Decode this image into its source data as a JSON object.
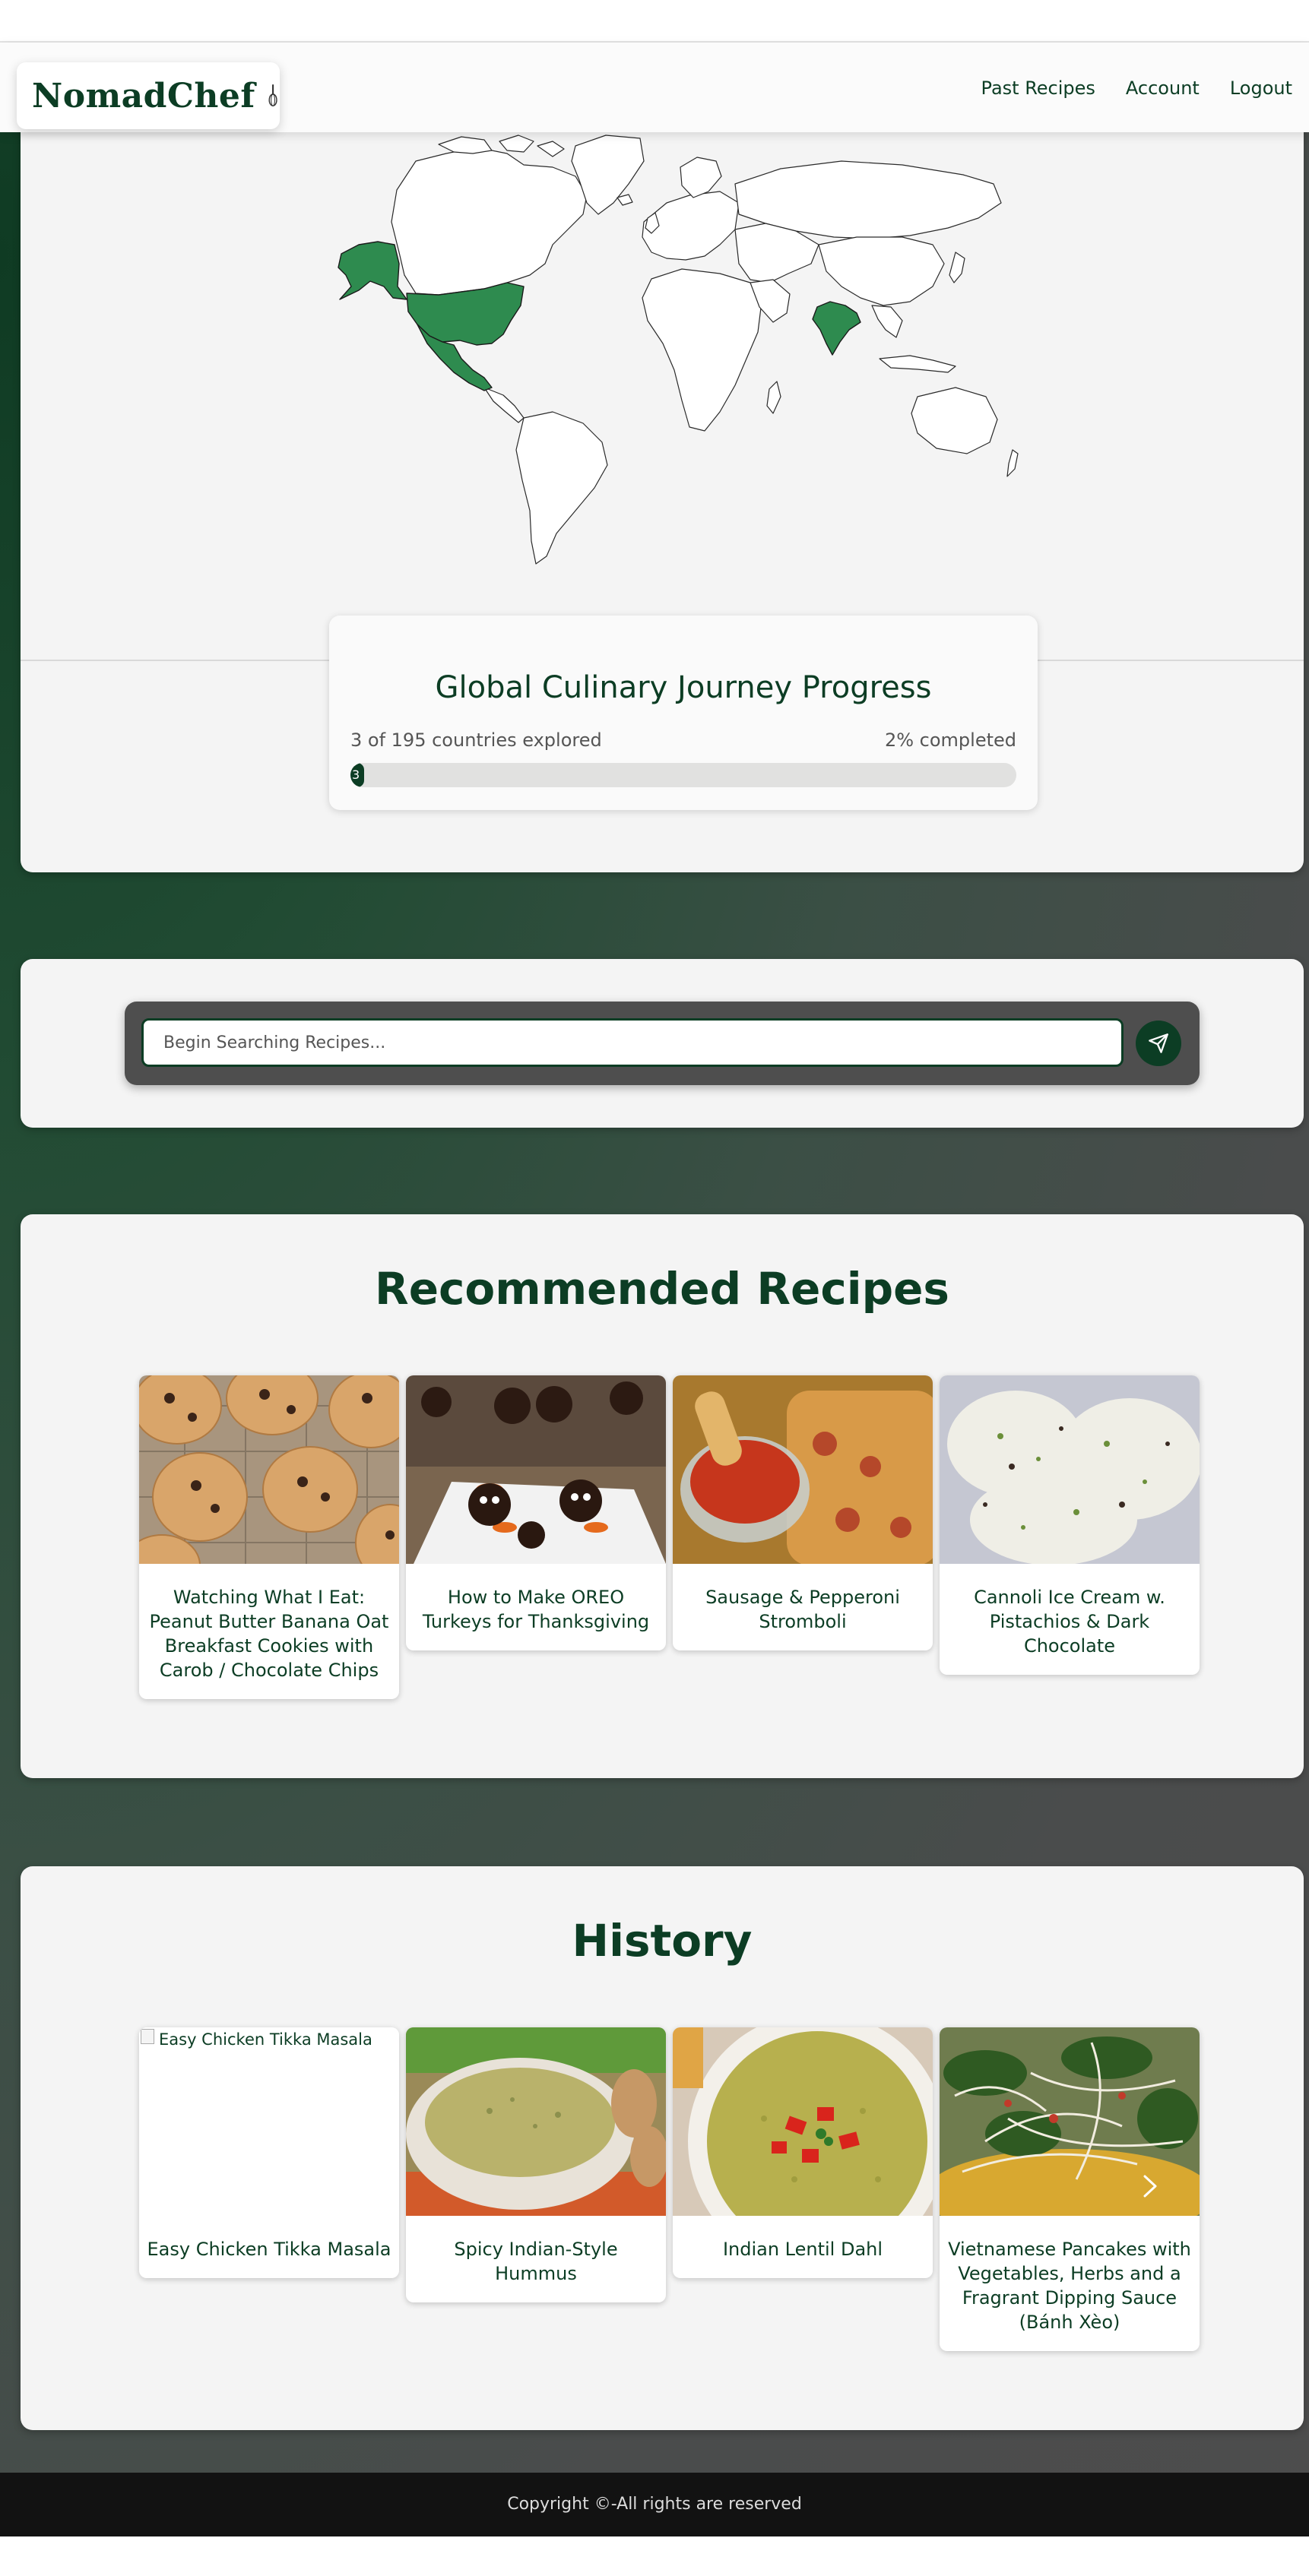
{
  "brand": {
    "name": "NomadChef",
    "icon": "whisk-icon"
  },
  "nav": {
    "items": [
      "Past Recipes",
      "Account",
      "Logout"
    ]
  },
  "map": {
    "highlighted_regions": [
      "Alaska",
      "United States",
      "Mexico",
      "India"
    ],
    "highlight_color": "#2e8b4f"
  },
  "progress": {
    "title": "Global Culinary Journey Progress",
    "explored_text": "3 of 195 countries explored",
    "percent_text": "2% completed",
    "bar_label": "3",
    "fraction": 0.02
  },
  "search": {
    "placeholder": "Begin Searching Recipes...",
    "value": "",
    "icon": "send-icon"
  },
  "recommended": {
    "title": "Recommended Recipes",
    "items": [
      {
        "title": "Watching What I Eat: Peanut Butter Banana Oat Breakfast Cookies with Carob / Chocolate Chips"
      },
      {
        "title": "How to Make OREO Turkeys for Thanksgiving"
      },
      {
        "title": "Sausage & Pepperoni Stromboli"
      },
      {
        "title": "Cannoli Ice Cream w. Pistachios & Dark Chocolate"
      }
    ]
  },
  "history": {
    "title": "History",
    "items": [
      {
        "title": "Easy Chicken Tikka Masala",
        "img_alt": "Easy Chicken Tikka Masala"
      },
      {
        "title": "Spicy Indian-Style Hummus"
      },
      {
        "title": "Indian Lentil Dahl"
      },
      {
        "title": "Vietnamese Pancakes with Vegetables, Herbs and a Fragrant Dipping Sauce (Bánh Xèo)"
      }
    ],
    "next_icon": "chevron-right-icon"
  },
  "footer": {
    "text": "Copyright ©-All rights are reserved"
  },
  "colors": {
    "brand": "#0c3d24",
    "card": "#f4f4f4",
    "footer": "#121212",
    "search_bar": "#4e4e4e"
  }
}
